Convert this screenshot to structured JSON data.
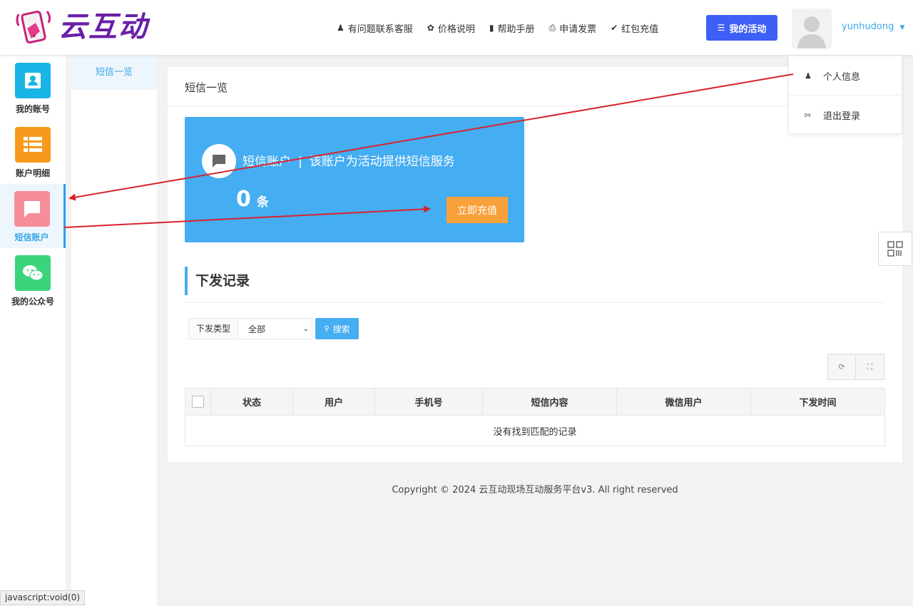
{
  "header": {
    "logo_text": "云互动",
    "nav": [
      {
        "label": "有问题联系客服",
        "icon": "user-plus-icon"
      },
      {
        "label": "价格说明",
        "icon": "settings-badge-icon"
      },
      {
        "label": "帮助手册",
        "icon": "book-icon"
      },
      {
        "label": "申请发票",
        "icon": "printer-icon"
      },
      {
        "label": "红包充值",
        "icon": "shield-check-icon"
      }
    ],
    "activity_button": "我的活动",
    "username": "yunhudong"
  },
  "dropdown": {
    "items": [
      {
        "label": "个人信息",
        "icon": "user-icon"
      },
      {
        "label": "退出登录",
        "icon": "logout-icon"
      }
    ]
  },
  "sidebar": {
    "items": [
      {
        "label": "我的账号",
        "icon": "contact-card-icon",
        "color": "#19b5e6"
      },
      {
        "label": "账户明细",
        "icon": "list-icon",
        "color": "#f79a1b"
      },
      {
        "label": "短信账户",
        "icon": "message-icon",
        "color": "#f78d99"
      },
      {
        "label": "我的公众号",
        "icon": "wechat-icon",
        "color": "#3bd47c"
      }
    ],
    "active_index": 2
  },
  "subnav": {
    "items": [
      {
        "label": "短信一览"
      }
    ]
  },
  "main": {
    "panel_title": "短信一览",
    "sms_card": {
      "title": "短信账户",
      "separator": "|",
      "description": "该账户为活动提供短信服务",
      "count": "0",
      "unit": "条",
      "recharge_button": "立即充值",
      "bg_color": "#45adf1"
    },
    "records": {
      "title": "下发记录",
      "filter_label": "下发类型",
      "filter_value": "全部",
      "search_button": "搜索",
      "columns": [
        "状态",
        "用户",
        "手机号",
        "短信内容",
        "微信用户",
        "下发时间"
      ],
      "empty_text": "没有找到匹配的记录"
    }
  },
  "footer": {
    "copyright": "Copyright © 2024 云互动现场互动服务平台v3. All right reserved"
  },
  "status_bar": {
    "text": "javascript:void(0)"
  }
}
